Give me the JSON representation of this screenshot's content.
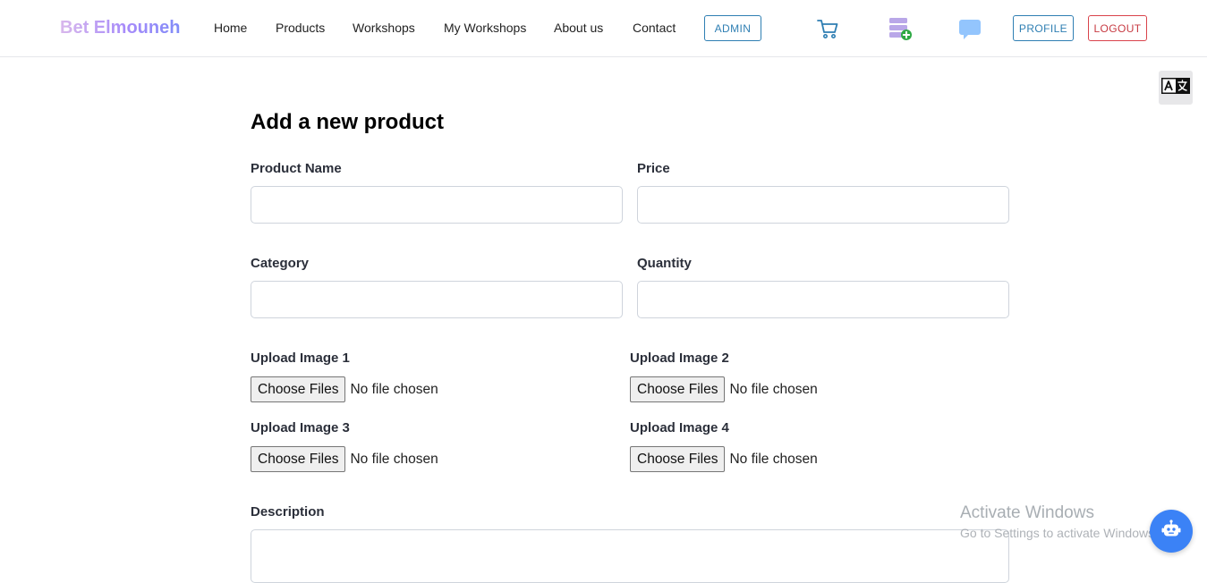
{
  "nav": {
    "brand": "Bet Elmouneh",
    "links": [
      "Home",
      "Products",
      "Workshops",
      "My Workshops",
      "About us",
      "Contact"
    ],
    "admin_label": "ADMIN",
    "profile_label": "PROFILE",
    "logout_label": "LOGOUT",
    "icons": [
      "cart-icon",
      "add-to-list-icon",
      "chat-icon",
      "translate-icon"
    ]
  },
  "form": {
    "title": "Add a new product",
    "product_name_label": "Product Name",
    "product_name_value": "",
    "price_label": "Price",
    "price_value": "",
    "category_label": "Category",
    "category_value": "",
    "quantity_label": "Quantity",
    "quantity_value": "",
    "uploads": [
      {
        "label": "Upload Image 1",
        "button": "Choose Files",
        "status": "No file chosen"
      },
      {
        "label": "Upload Image 2",
        "button": "Choose Files",
        "status": "No file chosen"
      },
      {
        "label": "Upload Image 3",
        "button": "Choose Files",
        "status": "No file chosen"
      },
      {
        "label": "Upload Image 4",
        "button": "Choose Files",
        "status": "No file chosen"
      }
    ],
    "description_label": "Description",
    "description_value": ""
  },
  "overlay": {
    "watermark_title": "Activate Windows",
    "watermark_subtitle": "Go to Settings to activate Windows."
  },
  "colors": {
    "primary_outline": "#2f7fb3",
    "danger_outline": "#d9434b",
    "chatbot": "#3b82f6"
  }
}
